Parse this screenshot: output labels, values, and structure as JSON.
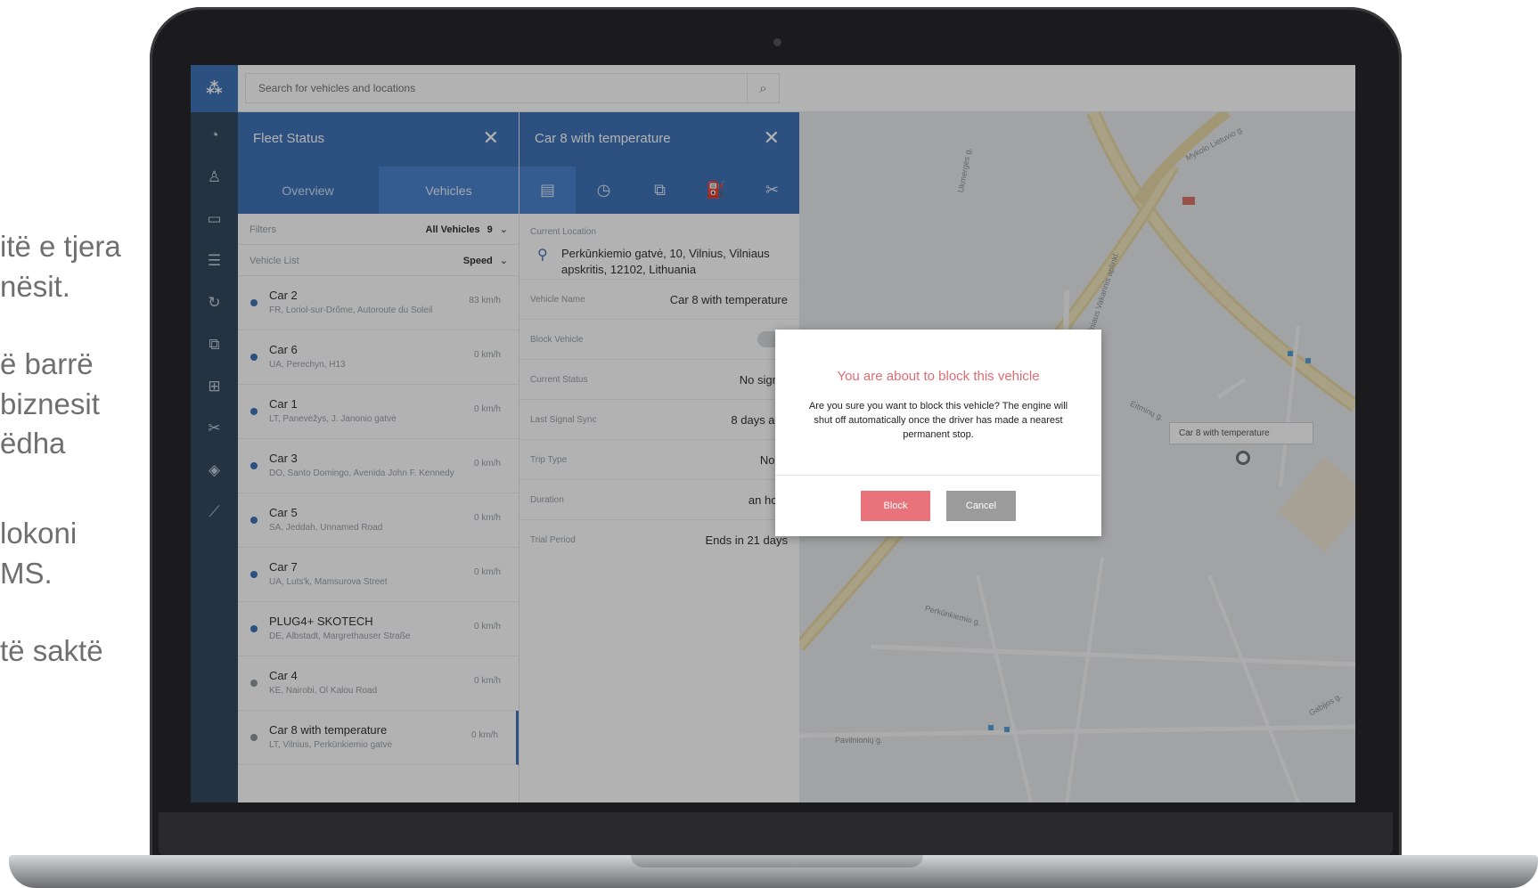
{
  "side_text": [
    "itë e tjera",
    "nësit.",
    "ë barrë",
    " biznesit",
    "ëdha",
    "lokoni",
    "MS.",
    "të saktë"
  ],
  "search": {
    "placeholder": "Search for vehicles and locations"
  },
  "fleet": {
    "title": "Fleet Status",
    "tabs": {
      "overview": "Overview",
      "vehicles": "Vehicles"
    },
    "filters": {
      "label": "Filters",
      "value": "All Vehicles",
      "count": "9"
    },
    "list": {
      "label": "Vehicle List",
      "sort": "Speed"
    },
    "vehicles": [
      {
        "name": "Car 2",
        "address": "FR, Loriol-sur-Drôme, Autoroute du Soleil",
        "speed": "83 km/h"
      },
      {
        "name": "Car 6",
        "address": "UA, Perechyn, H13",
        "speed": "0 km/h"
      },
      {
        "name": "Car 1",
        "address": "LT, Panevėžys, J. Janonio gatvė",
        "speed": "0 km/h"
      },
      {
        "name": "Car 3",
        "address": "DO, Santo Domingo, Avenida John F. Kennedy",
        "speed": "0 km/h"
      },
      {
        "name": "Car 5",
        "address": "SA, Jeddah, Unnamed Road",
        "speed": "0 km/h"
      },
      {
        "name": "Car 7",
        "address": "UA, Luts'k, Mamsurova Street",
        "speed": "0 km/h"
      },
      {
        "name": "PLUG4+ SKOTECH",
        "address": "DE, Albstadt, Margrethauser Straße",
        "speed": "0 km/h"
      },
      {
        "name": "Car 4",
        "address": "KE, Nairobi, Ol Kalou Road",
        "speed": "0 km/h"
      },
      {
        "name": "Car 8 with temperature",
        "address": "LT, Vilnius, Perkūnkiemio gatvė",
        "speed": "0 km/h"
      }
    ]
  },
  "detail": {
    "title": "Car 8 with temperature",
    "location_label": "Current Location",
    "location": "Perkūnkiemio gatvė, 10, Vilnius, Vilniaus apskritis, 12102, Lithuania",
    "rows": [
      {
        "key": "Vehicle Name",
        "value": "Car 8 with temperature"
      },
      {
        "key": "Block Vehicle",
        "value": ""
      },
      {
        "key": "Current Status",
        "value": "No signal"
      },
      {
        "key": "Last Signal Sync",
        "value": "8 days ago"
      },
      {
        "key": "Trip Type",
        "value": "None"
      },
      {
        "key": "Duration",
        "value": "an hour"
      },
      {
        "key": "Trial Period",
        "value": "Ends in 21 days"
      }
    ]
  },
  "map": {
    "streets": [
      "Mykolo Lietuvio g.",
      "Vilniaus Vakarinis aplinkl.",
      "Perkūnkiemio g.",
      "Pavilnionių g.",
      "Gabijos g.",
      "Ukmergės g.",
      "Eitminų g."
    ],
    "tag": "Car 8 with temperature"
  },
  "modal": {
    "title": "You are about to block this vehicle",
    "text": "Are you sure you want to block this vehicle? The engine will shut off automatically once the driver has made a nearest permanent stop.",
    "block_label": "Block",
    "cancel_label": "Cancel"
  },
  "colors": {
    "primary": "#3f73b8",
    "rail": "#34495e",
    "danger": "#e9737b",
    "neutral": "#9b9b9b"
  }
}
